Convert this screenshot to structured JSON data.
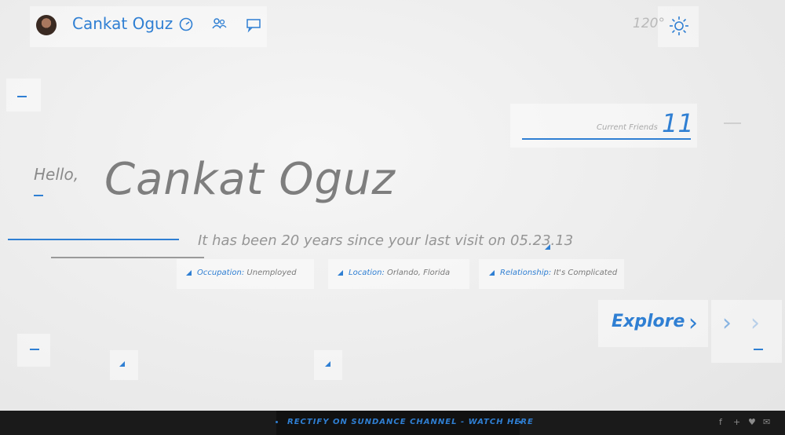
{
  "header": {
    "user_name": "Cankat Oguz",
    "icons": [
      "gauge-icon",
      "friends-icon",
      "chat-icon"
    ],
    "temperature": "120°",
    "weather_icon": "sun-icon"
  },
  "friends": {
    "label": "Current Friends",
    "count": "11"
  },
  "greeting": {
    "hello": "Hello,",
    "name": "Cankat Oguz"
  },
  "visit_text": "It has been 20 years since your last visit on 05.23.13",
  "info": [
    {
      "label": "Occupation:",
      "value": "Unemployed"
    },
    {
      "label": "Location:",
      "value": "Orlando, Florida"
    },
    {
      "label": "Relationship:",
      "value": "It's Complicated"
    }
  ],
  "explore": {
    "label": "Explore",
    "chevron": "›"
  },
  "footer": {
    "link": "RECTIFY ON SUNDANCE CHANNEL - WATCH HERE",
    "social": [
      "f",
      "+",
      "♥",
      "✉"
    ]
  },
  "colors": {
    "accent": "#2f7fd3",
    "footer_bg": "#1a1a1a",
    "background": "#ececec"
  }
}
